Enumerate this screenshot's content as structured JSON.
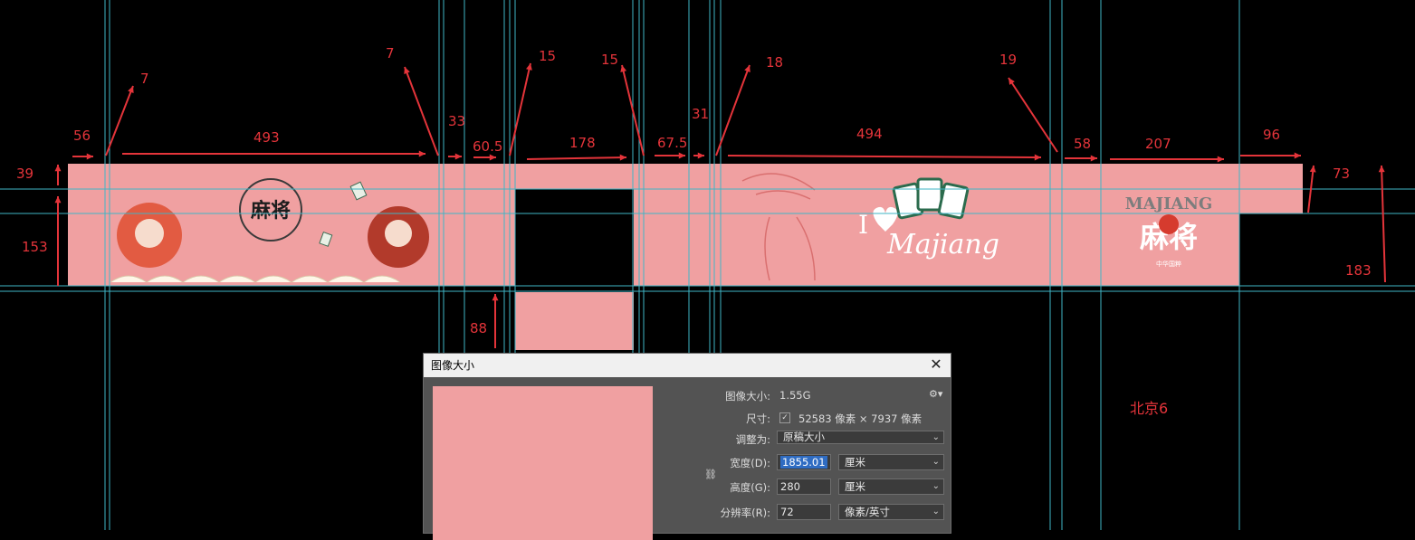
{
  "dimensions": {
    "top_row": [
      "56",
      "493",
      "33",
      "60.5",
      "178",
      "67.5",
      "31",
      "494",
      "58",
      "207",
      "96"
    ],
    "diagonals": [
      "7",
      "7",
      "15",
      "15",
      "18",
      "19"
    ],
    "left_side": [
      "39",
      "153"
    ],
    "right_side": [
      "73",
      "183"
    ],
    "bottom": "88"
  },
  "panel_text": {
    "left_logo": "麻将",
    "right_logo_en": "MAJIANG",
    "right_logo_cn": "麻将",
    "right_logo_sub": "中华国粹",
    "i_love": "I",
    "majiang_script": "Majiang"
  },
  "note": "北京6",
  "dialog": {
    "title": "图像大小",
    "image_size_label": "图像大小:",
    "image_size_value": "1.55G",
    "dimensions_label": "尺寸:",
    "dimensions_value": "52583 像素 × 7937 像素",
    "fit_to_label": "调整为:",
    "fit_to_value": "原稿大小",
    "width_label": "宽度(D):",
    "width_value": "1855.01",
    "width_unit": "厘米",
    "height_label": "高度(G):",
    "height_value": "280",
    "height_unit": "厘米",
    "resolution_label": "分辨率(R):",
    "resolution_value": "72",
    "resolution_unit": "像素/英寸"
  },
  "colors": {
    "panel_pink": "#f0a0a1",
    "dimension_red": "#e4343a",
    "guide_cyan": "#3fb6c6",
    "dialog_bg": "#535353"
  }
}
